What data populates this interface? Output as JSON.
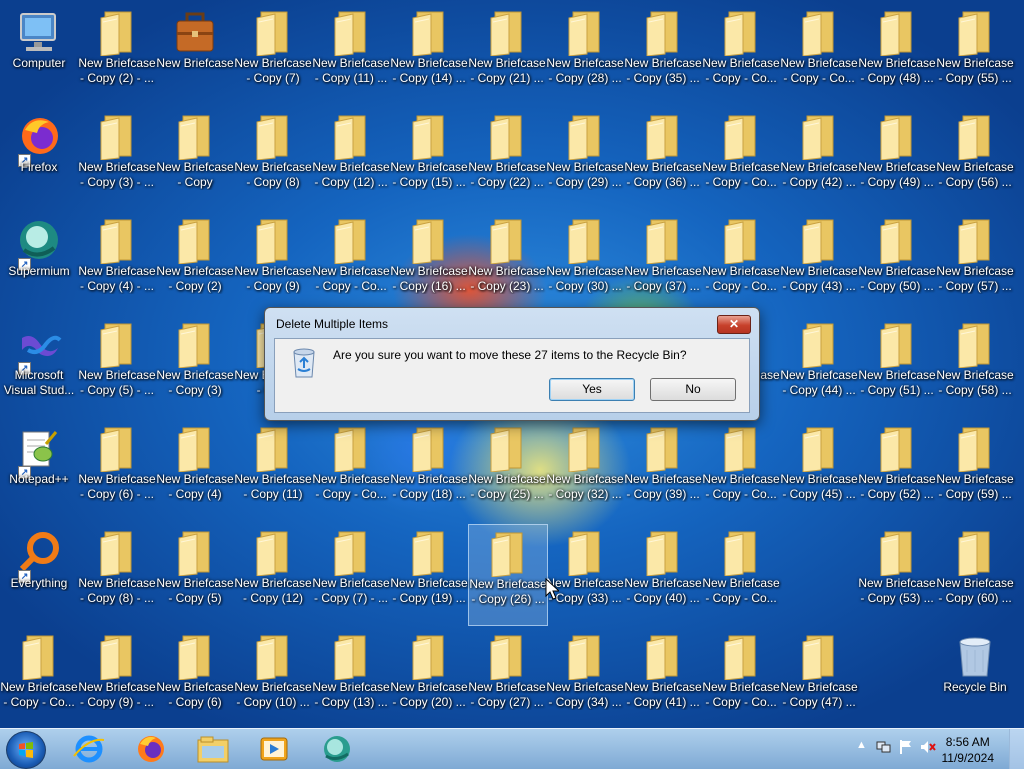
{
  "desktop": {
    "left_icons": [
      {
        "name": "computer",
        "lines": [
          "Computer"
        ],
        "kind": "computer"
      },
      {
        "name": "firefox",
        "lines": [
          "Firefox"
        ],
        "kind": "firefox"
      },
      {
        "name": "supermium",
        "lines": [
          "Supermium"
        ],
        "kind": "supermium"
      },
      {
        "name": "visual-studio",
        "lines": [
          "Microsoft",
          "Visual Stud..."
        ],
        "kind": "vs"
      },
      {
        "name": "notepadpp",
        "lines": [
          "Notepad++"
        ],
        "kind": "npp"
      },
      {
        "name": "everything",
        "lines": [
          "Everything"
        ],
        "kind": "everything"
      },
      {
        "name": "briefcase-copy-co",
        "lines": [
          "New Briefcase",
          "- Copy - Co..."
        ],
        "kind": "folder"
      }
    ],
    "grid_columns": [
      [
        "- Copy (2) - ...",
        "- Copy (3) - ...",
        "- Copy (4) - ...",
        "- Copy (5) - ...",
        "- Copy (6) - ...",
        "- Copy (8) - ...",
        "- Copy (9) - ..."
      ],
      [
        "",
        "- Copy",
        "- Copy (2)",
        "- Copy (3)",
        "- Copy (4)",
        "- Copy (5)",
        "- Copy (6)"
      ],
      [
        "- Copy (7)",
        "- Copy (8)",
        "- Copy (9)",
        "- Co...",
        "- Copy (11)",
        "- Copy (12)",
        "- Copy (10) ..."
      ],
      [
        "- Copy (11) ...",
        "- Copy (12) ...",
        "- Copy - Co...",
        "",
        "- Copy - Co...",
        "- Copy (7) - ...",
        "- Copy (13) ..."
      ],
      [
        "- Copy (14) ...",
        "- Copy (15) ...",
        "- Copy (16) ...",
        "",
        "- Copy (18) ...",
        "- Copy (19) ...",
        "- Copy (20) ..."
      ],
      [
        "- Copy (21) ...",
        "- Copy (22) ...",
        "- Copy (23) ...",
        "",
        "- Copy (25) ...",
        "- Copy (26) ...",
        "- Copy (27) ..."
      ],
      [
        "- Copy (28) ...",
        "- Copy (29) ...",
        "- Copy (30) ...",
        "",
        "- Copy (32) ...",
        "- Copy (33) ...",
        "- Copy (34) ..."
      ],
      [
        "- Copy (35) ...",
        "- Copy (36) ...",
        "- Copy (37) ...",
        "",
        "- Copy (39) ...",
        "- Copy (40) ...",
        "- Copy (41) ..."
      ],
      [
        "- Copy - Co...",
        "- Copy - Co...",
        "- Copy - Co...",
        "o...",
        "- Copy - Co...",
        "- Copy - Co...",
        "- Copy - Co..."
      ],
      [
        "- Copy - Co...",
        "- Copy (42) ...",
        "- Copy (43) ...",
        "- Copy (44) ...",
        "- Copy (45) ...",
        "",
        "- Copy (47) ..."
      ],
      [
        "- Copy (48) ...",
        "- Copy (49) ...",
        "- Copy (50) ...",
        "- Copy (51) ...",
        "- Copy (52) ...",
        "- Copy (53) ...",
        ""
      ],
      [
        "- Copy (55) ...",
        "- Copy (56) ...",
        "- Copy (57) ...",
        "- Copy (58) ...",
        "- Copy (59) ...",
        "- Copy (60) ...",
        ""
      ]
    ],
    "folder_title": "New Briefcase",
    "briefcase_title": "New Briefcase",
    "recycle_bin_label": "Recycle Bin",
    "selected_label": "New Briefcase"
  },
  "dialog": {
    "title": "Delete Multiple Items",
    "message": "Are you sure you want to move these 27 items to the Recycle Bin?",
    "yes_label": "Yes",
    "no_label": "No",
    "close_glyph": "✕"
  },
  "taskbar": {
    "apps": [
      "internet-explorer",
      "firefox",
      "file-explorer",
      "media-player",
      "supermium"
    ],
    "time": "8:56 AM",
    "date": "11/9/2024"
  }
}
